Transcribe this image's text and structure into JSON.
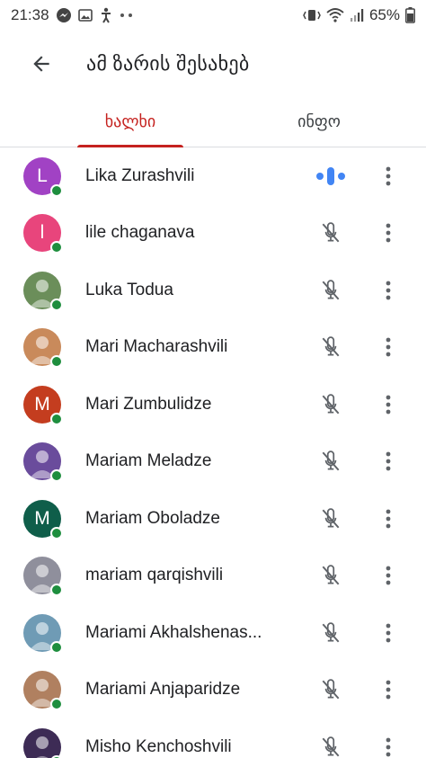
{
  "status_bar": {
    "time": "21:38",
    "battery": "65%"
  },
  "header": {
    "title": "ამ ზარის შესახებ"
  },
  "tabs": [
    {
      "label": "ხალხი",
      "active": true
    },
    {
      "label": "ინფო",
      "active": false
    }
  ],
  "colors": {
    "accent": "#c5221f",
    "online": "#1e8e3e",
    "speaking": "#4285f4"
  },
  "participants": [
    {
      "name": "Lika Zurashvili",
      "initial": "L",
      "avatar_color": "#a142c4",
      "mic": "speaking"
    },
    {
      "name": "lile chaganava",
      "initial": "l",
      "avatar_color": "#e8457c",
      "mic": "muted"
    },
    {
      "name": "Luka Todua",
      "initial": "",
      "avatar_color": "#6b8e5a",
      "mic": "muted"
    },
    {
      "name": "Mari Macharashvili",
      "initial": "",
      "avatar_color": "#c98a5b",
      "mic": "muted"
    },
    {
      "name": "Mari Zumbulidze",
      "initial": "M",
      "avatar_color": "#c43d1f",
      "mic": "muted"
    },
    {
      "name": "Mariam Meladze",
      "initial": "",
      "avatar_color": "#6a4c9c",
      "mic": "muted"
    },
    {
      "name": "Mariam Oboladze",
      "initial": "M",
      "avatar_color": "#0f5e4a",
      "mic": "muted"
    },
    {
      "name": "mariam qarqishvili",
      "initial": "",
      "avatar_color": "#8f8f9c",
      "mic": "muted"
    },
    {
      "name": "Mariami Akhalshenas...",
      "initial": "",
      "avatar_color": "#6f9bb5",
      "mic": "muted"
    },
    {
      "name": "Mariami Anjaparidze",
      "initial": "",
      "avatar_color": "#b08060",
      "mic": "muted"
    },
    {
      "name": "Misho Kenchoshvili",
      "initial": "",
      "avatar_color": "#3d2b55",
      "mic": "muted"
    }
  ]
}
